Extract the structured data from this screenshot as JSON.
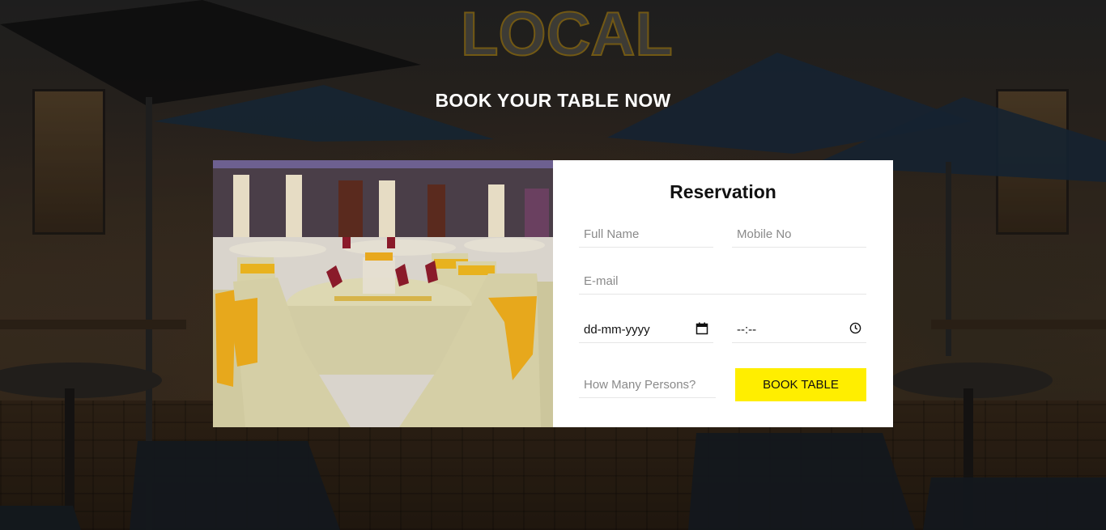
{
  "page": {
    "heading": "BOOK YOUR TABLE NOW"
  },
  "background": {
    "sign_text": "LOCAL"
  },
  "reservation": {
    "title": "Reservation",
    "full_name_placeholder": "Full Name",
    "mobile_placeholder": "Mobile No",
    "email_placeholder": "E-mail",
    "date_value": "dd-mm-yyyy",
    "time_value": "--:--",
    "persons_placeholder": "How Many Persons?",
    "submit_label": "BOOK TABLE"
  },
  "colors": {
    "accent": "#ffee00",
    "card_bg": "#ffffff"
  },
  "icons": {
    "date": "calendar-icon",
    "time": "clock-icon"
  }
}
